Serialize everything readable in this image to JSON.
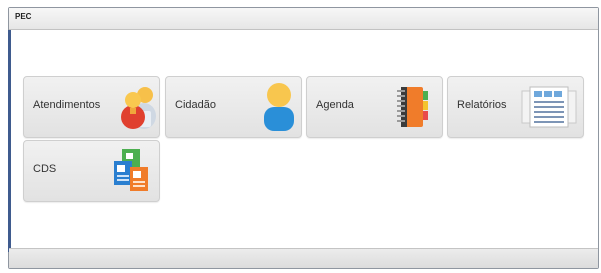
{
  "window": {
    "title": "PEC"
  },
  "tiles": [
    {
      "label": "Atendimentos",
      "icon": "users-icon"
    },
    {
      "label": "Cidadão",
      "icon": "person-icon"
    },
    {
      "label": "Agenda",
      "icon": "agenda-book-icon"
    },
    {
      "label": "Relatórios",
      "icon": "reports-icon"
    },
    {
      "label": "CDS",
      "icon": "cds-forms-icon"
    }
  ],
  "colors": {
    "window_border": "#8f96a0",
    "left_accent": "#3f5b8e",
    "tile_bg": "#e8e8e8"
  }
}
